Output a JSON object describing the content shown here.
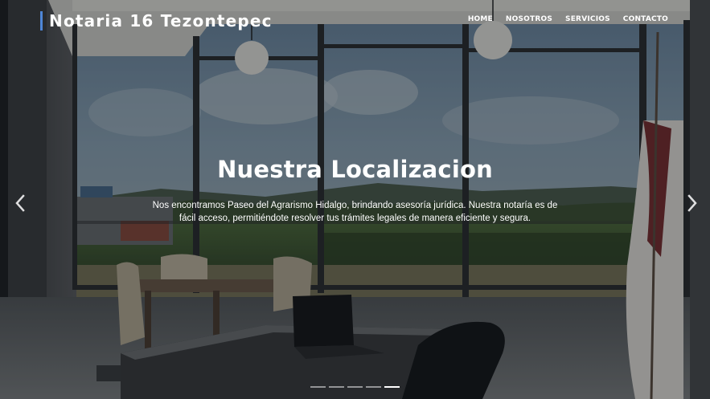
{
  "brand": {
    "name": "Notaria 16 Tezontepec",
    "accent_color": "#4e86d6"
  },
  "nav": {
    "items": [
      {
        "label": "HOME"
      },
      {
        "label": "NOSOTROS"
      },
      {
        "label": "SERVICIOS"
      },
      {
        "label": "CONTACTO"
      }
    ]
  },
  "hero": {
    "title": "Nuestra Localizacion",
    "text": "Nos encontramos Paseo del Agrarismo Hidalgo, brindando asesoría jurídica. Nuestra notaría es de fácil acceso, permitiéndote resolver tus trámites legales de manera eficiente y segura."
  },
  "carousel": {
    "prev_icon": "chevron-left-icon",
    "next_icon": "chevron-right-icon",
    "slide_count": 5,
    "active_slide": 5
  }
}
